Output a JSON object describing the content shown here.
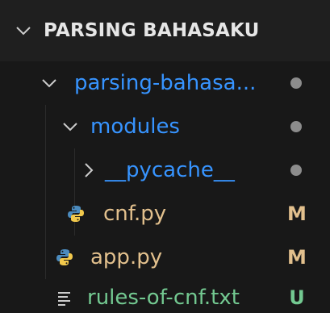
{
  "explorer": {
    "section_title": "PARSING BAHASAKU",
    "colors": {
      "folder_blue": "#3794ff",
      "modified": "#e2c08d",
      "untracked": "#73c991",
      "dot_gray": "#8c8c8c",
      "python_blue": "#4b8bbe",
      "python_yellow": "#f2c94c"
    },
    "items": [
      {
        "label": "parsing-bahasa...",
        "type": "folder",
        "expanded": true,
        "icon": "chevron-down-icon",
        "badge": "dot"
      },
      {
        "label": "modules",
        "type": "folder",
        "expanded": true,
        "icon": "chevron-down-icon",
        "badge": "dot"
      },
      {
        "label": "__pycache__",
        "type": "folder",
        "expanded": false,
        "icon": "chevron-right-icon",
        "badge": "dot"
      },
      {
        "label": "cnf.py",
        "type": "file",
        "icon": "python-file-icon",
        "badge": "M"
      },
      {
        "label": "app.py",
        "type": "file",
        "icon": "python-file-icon",
        "badge": "M"
      },
      {
        "label": "rules-of-cnf.txt",
        "type": "file",
        "icon": "text-file-icon",
        "badge": "U"
      }
    ]
  }
}
